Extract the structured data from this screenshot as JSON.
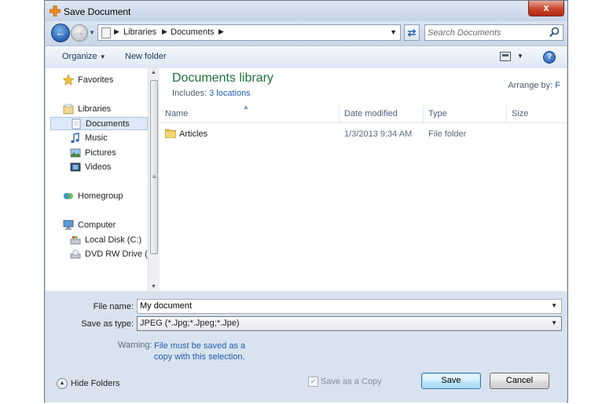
{
  "window": {
    "title": "Save Document",
    "close_label": "x"
  },
  "nav": {
    "breadcrumb": [
      "Libraries",
      "Documents"
    ],
    "search_placeholder": "Search Documents"
  },
  "toolbar": {
    "organize_label": "Organize",
    "new_folder_label": "New folder"
  },
  "sidebar": {
    "items": [
      {
        "label": "Favorites"
      },
      {
        "label": "Libraries"
      },
      {
        "label": "Documents"
      },
      {
        "label": "Music"
      },
      {
        "label": "Pictures"
      },
      {
        "label": "Videos"
      },
      {
        "label": "Homegroup"
      },
      {
        "label": "Computer"
      },
      {
        "label": "Local Disk (C:)"
      },
      {
        "label": "DVD RW Drive (D"
      }
    ],
    "selected": "Documents"
  },
  "library": {
    "title": "Documents library",
    "includes_label": "Includes:",
    "includes_link": "3 locations",
    "arrange_label": "Arrange by:",
    "arrange_value": "F"
  },
  "columns": [
    "Name",
    "Date modified",
    "Type",
    "Size"
  ],
  "files": [
    {
      "name": "Articles",
      "date": "1/3/2013 9:34 AM",
      "type": "File folder",
      "size": ""
    }
  ],
  "form": {
    "filename_label": "File name:",
    "filename_value": "My document",
    "savetype_label": "Save as type:",
    "savetype_value": "JPEG (*.Jpg;*.Jpeg;*.Jpe)",
    "warning_label": "Warning:",
    "warning_text": "File must be saved as a copy with this selection.",
    "hide_folders_label": "Hide Folders",
    "save_copy_label": "Save as a Copy",
    "save_copy_checked": true,
    "save_label": "Save",
    "cancel_label": "Cancel"
  },
  "colors": {
    "accent_green": "#1e6f3d",
    "link_blue": "#1f5dad",
    "close_red": "#c7432b",
    "chrome_blue": "#c9d6e6"
  }
}
